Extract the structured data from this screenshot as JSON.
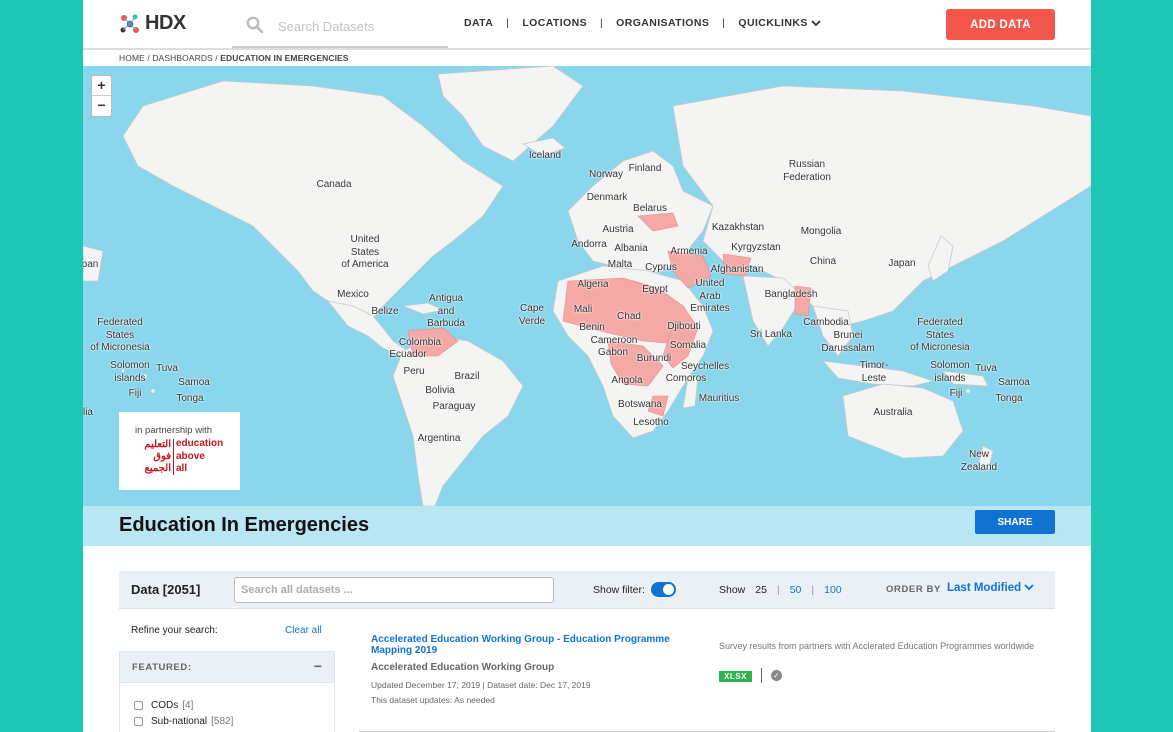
{
  "header": {
    "logo_text": "HDX",
    "search_placeholder": "Search Datasets",
    "nav": [
      {
        "label": "DATA"
      },
      {
        "label": "LOCATIONS"
      },
      {
        "label": "ORGANISATIONS"
      },
      {
        "label": "QUICKLINKS"
      }
    ],
    "nav_separator": "|",
    "add_data_label": "ADD DATA",
    "accent_color": "#f2564d"
  },
  "breadcrumb": {
    "home": "HOME",
    "sep": "/",
    "dashboards": "DASHBOARDS",
    "current": "EDUCATION IN EMERGENCIES"
  },
  "map": {
    "zoom_in": "+",
    "zoom_out": "−",
    "highlight_color": "#f5a9a6",
    "labels": {
      "iceland": "Iceland",
      "finland": "Finland",
      "norway": "Norway",
      "denmark": "Denmark",
      "russia_1": "Russian",
      "russia_2": "Federation",
      "canada": "Canada",
      "belarus": "Belarus",
      "austria": "Austria",
      "kazakhstan": "Kazakhstan",
      "mongolia": "Mongolia",
      "usa_1": "United",
      "usa_2": "States",
      "usa_3": "of America",
      "andorra": "Andorra",
      "albania": "Albania",
      "armenia": "Armenia",
      "kyrgyzstan": "Kyrgyzstan",
      "malta": "Malta",
      "cyprus": "Cyprus",
      "afghanistan": "Afghanistan",
      "china": "China",
      "japan": "Japan",
      "algeria": "Algeria",
      "egypt": "Egypt",
      "uae_1": "United",
      "uae_2": "Arab",
      "uae_3": "Emirates",
      "bangladesh": "Bangladesh",
      "mexico": "Mexico",
      "antigua_1": "Antigua",
      "antigua_2": "and",
      "antigua_3": "Barbuda",
      "belize": "Belize",
      "cape_verde_1": "Cape",
      "cape_verde_2": "Verde",
      "mali": "Mali",
      "chad": "Chad",
      "benin": "Benin",
      "djibouti": "Djibouti",
      "cambodia": "Cambodia",
      "sri_lanka": "Sri Lanka",
      "brunei_1": "Brunei",
      "brunei_2": "Darussalam",
      "fsm_l_1": "Federated",
      "fsm_l_2": "States",
      "fsm_l_3": "of Micronesia",
      "fsm_r_1": "Federated",
      "fsm_r_2": "States",
      "fsm_r_3": "of Micronesia",
      "colombia": "Colombia",
      "ecuador": "Ecuador",
      "cameroon": "Cameroon",
      "gabon": "Gabon",
      "somalia": "Somalia",
      "burundi": "Burundi",
      "seychelles": "Seychelles",
      "solomon_l_1": "Solomon",
      "solomon_l_2": "islands",
      "tuva_l": "Tuva",
      "samoa_l": "Samoa",
      "tonga_l": "Tonga",
      "fiji_l": "Fiji",
      "solomon_r_1": "Solomon",
      "solomon_r_2": "islands",
      "tuva_r": "Tuva",
      "samoa_r": "Samoa",
      "tonga_r": "Tonga",
      "fiji_r": "Fiji",
      "peru": "Peru",
      "brazil": "Brazil",
      "bolivia": "Bolivia",
      "paraguay": "Paraguay",
      "argentina": "Argentina",
      "angola": "Angola",
      "comoros": "Comoros",
      "mauritius": "Mauritius",
      "botswana": "Botswana",
      "lesotho": "Lesotho",
      "timor_1": "Timor-",
      "timor_2": "Leste",
      "australia": "Australia",
      "nz_1": "New",
      "nz_2": "Zealand",
      "edge_pan": "pan",
      "edge_lia": "lia"
    },
    "partner": {
      "top": "in partnership with",
      "ar_1": "التعليم",
      "ar_2": "فوق",
      "ar_3": "الجميع",
      "en_1": "education",
      "en_2": "above",
      "en_3": "all"
    }
  },
  "title_band": {
    "title": "Education In Emergencies",
    "share_label": "SHARE"
  },
  "toolbar": {
    "data_label": "Data [2051]",
    "search_placeholder": "Search all datasets ...",
    "show_filter_label": "Show filter:",
    "show_filter_on": true,
    "show_label": "Show",
    "page_sizes": [
      "25",
      "50",
      "100"
    ],
    "page_sep": "|",
    "order_by_label": "ORDER BY",
    "order_by_value": "Last Modified"
  },
  "filters": {
    "refine_label": "Refine your search:",
    "clear_all": "Clear all",
    "featured_label": "FEATURED:",
    "collapse_symbol": "−",
    "items": [
      {
        "label": "CODs",
        "count": "[4]"
      },
      {
        "label": "Sub-national",
        "count": "[582]"
      }
    ]
  },
  "results": [
    {
      "title": "Accelerated Education Working Group - Education Programme Mapping 2019",
      "org": "Accelerated Education Working Group",
      "updated": "Updated December 17, 2019 | Dataset date: Dec 17, 2019",
      "frequency": "This dataset updates: As needed",
      "description": "Survey results from partners with Acclerated Education Programmes worldwide",
      "format": "XLSX",
      "check": "✓"
    }
  ]
}
